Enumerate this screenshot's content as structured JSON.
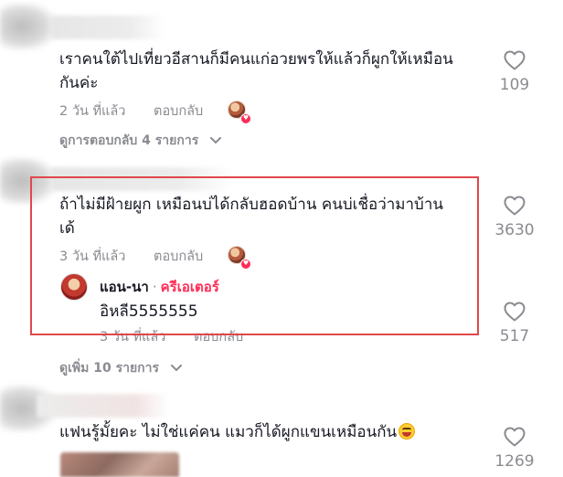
{
  "comments": [
    {
      "text": "เราคนใต้ไปเที่ยวอีสานก็มีคนแก่อวยพรให้แล้วก็ผูกให้เหมือนกันค่ะ",
      "line1": "เราคนใต้ไปเที่ยวอีสานก็มีคนแก่อวยพรให้แล้วก็ผูกให้เหมือน",
      "line2": "กันค่ะ",
      "time": "2 วัน ที่แล้ว",
      "reply_label": "ตอบกลับ",
      "likes": "109",
      "view_replies": "ดูการตอบกลับ 4 รายการ"
    },
    {
      "text": "ถ้าไม่มีฝ้ายผูก เหมือนบ่ได้กลับฮอดบ้าน คนบ่เชื่อว่ามาบ้านเด้",
      "line1": "ถ้าไม่มีฝ้ายผูก เหมือนบ่ได้กลับฮอดบ้าน คนบ่เชื่อว่ามาบ้าน",
      "line2": "เด้",
      "time": "3 วัน ที่แล้ว",
      "reply_label": "ตอบกลับ",
      "likes": "3630",
      "reply": {
        "author": "แอน-นา",
        "separator": "·",
        "badge": "ครีเอเตอร์",
        "text": "อิหลี5555555",
        "time": "3 วัน ที่แล้ว",
        "reply_label": "ตอบกลับ",
        "likes": "517"
      },
      "view_more": "ดูเพิ่ม 10 รายการ"
    },
    {
      "text": "แฟนรู้มั้ยคะ ไม่ใช่แค่คน แมวก็ได้ผูกแขนเหมือนกัน",
      "likes": "1269"
    }
  ],
  "icons": {
    "like": "heart-outline-icon",
    "expand": "chevron-down-icon",
    "creator_liked": "creator-liked-heart-icon",
    "emoji": "grinning-squinting-face-emoji"
  },
  "colors": {
    "text": "#161823",
    "secondary": "#8a8b91",
    "creator_badge": "#fe2c55",
    "highlight_box": "#e0474c"
  }
}
